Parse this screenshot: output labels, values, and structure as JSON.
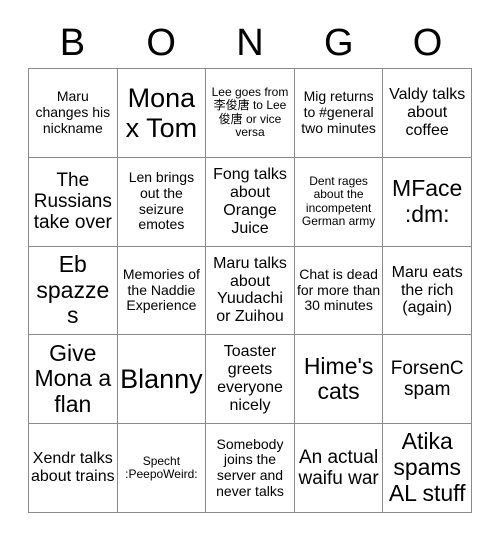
{
  "card": {
    "header_letters": [
      "B",
      "O",
      "N",
      "G",
      "O"
    ],
    "grid": {
      "rows": 5,
      "columns": 5,
      "cells": [
        {
          "text": "Maru changes his nickname",
          "size": "sm"
        },
        {
          "text": "Mona x Tom",
          "size": "xxl"
        },
        {
          "text": "Lee goes from 李俊唐 to Lee俊唐 or vice versa",
          "size": "xs"
        },
        {
          "text": "Mig returns to #general two minutes",
          "size": "sm"
        },
        {
          "text": "Valdy talks about coffee",
          "size": "md"
        },
        {
          "text": "The Russians take over",
          "size": "lg"
        },
        {
          "text": "Len brings out the seizure emotes",
          "size": "sm"
        },
        {
          "text": "Fong talks about Orange Juice",
          "size": "md"
        },
        {
          "text": "Dent rages about the incompetent German army",
          "size": "xs"
        },
        {
          "text": "MFace :dm:",
          "size": "xl"
        },
        {
          "text": "Eb spazzes",
          "size": "xl"
        },
        {
          "text": "Memories of the Naddie Experience",
          "size": "sm"
        },
        {
          "text": "Maru talks about Yuudachi or Zuihou",
          "size": "md"
        },
        {
          "text": "Chat is dead for more than 30 minutes",
          "size": "sm"
        },
        {
          "text": "Maru eats the rich (again)",
          "size": "md"
        },
        {
          "text": "Give Mona a flan",
          "size": "xl"
        },
        {
          "text": "Blanny",
          "size": "xxl"
        },
        {
          "text": "Toaster greets everyone nicely",
          "size": "md"
        },
        {
          "text": "Hime's cats",
          "size": "xl"
        },
        {
          "text": "ForsenC spam",
          "size": "lg"
        },
        {
          "text": "Xendr talks about trains",
          "size": "md"
        },
        {
          "text": "Specht :PeepoWeird:",
          "size": "xs"
        },
        {
          "text": "Somebody joins the server and never talks",
          "size": "sm"
        },
        {
          "text": "An actual waifu war",
          "size": "lg"
        },
        {
          "text": "Atika spams AL stuff",
          "size": "xl"
        }
      ]
    }
  }
}
